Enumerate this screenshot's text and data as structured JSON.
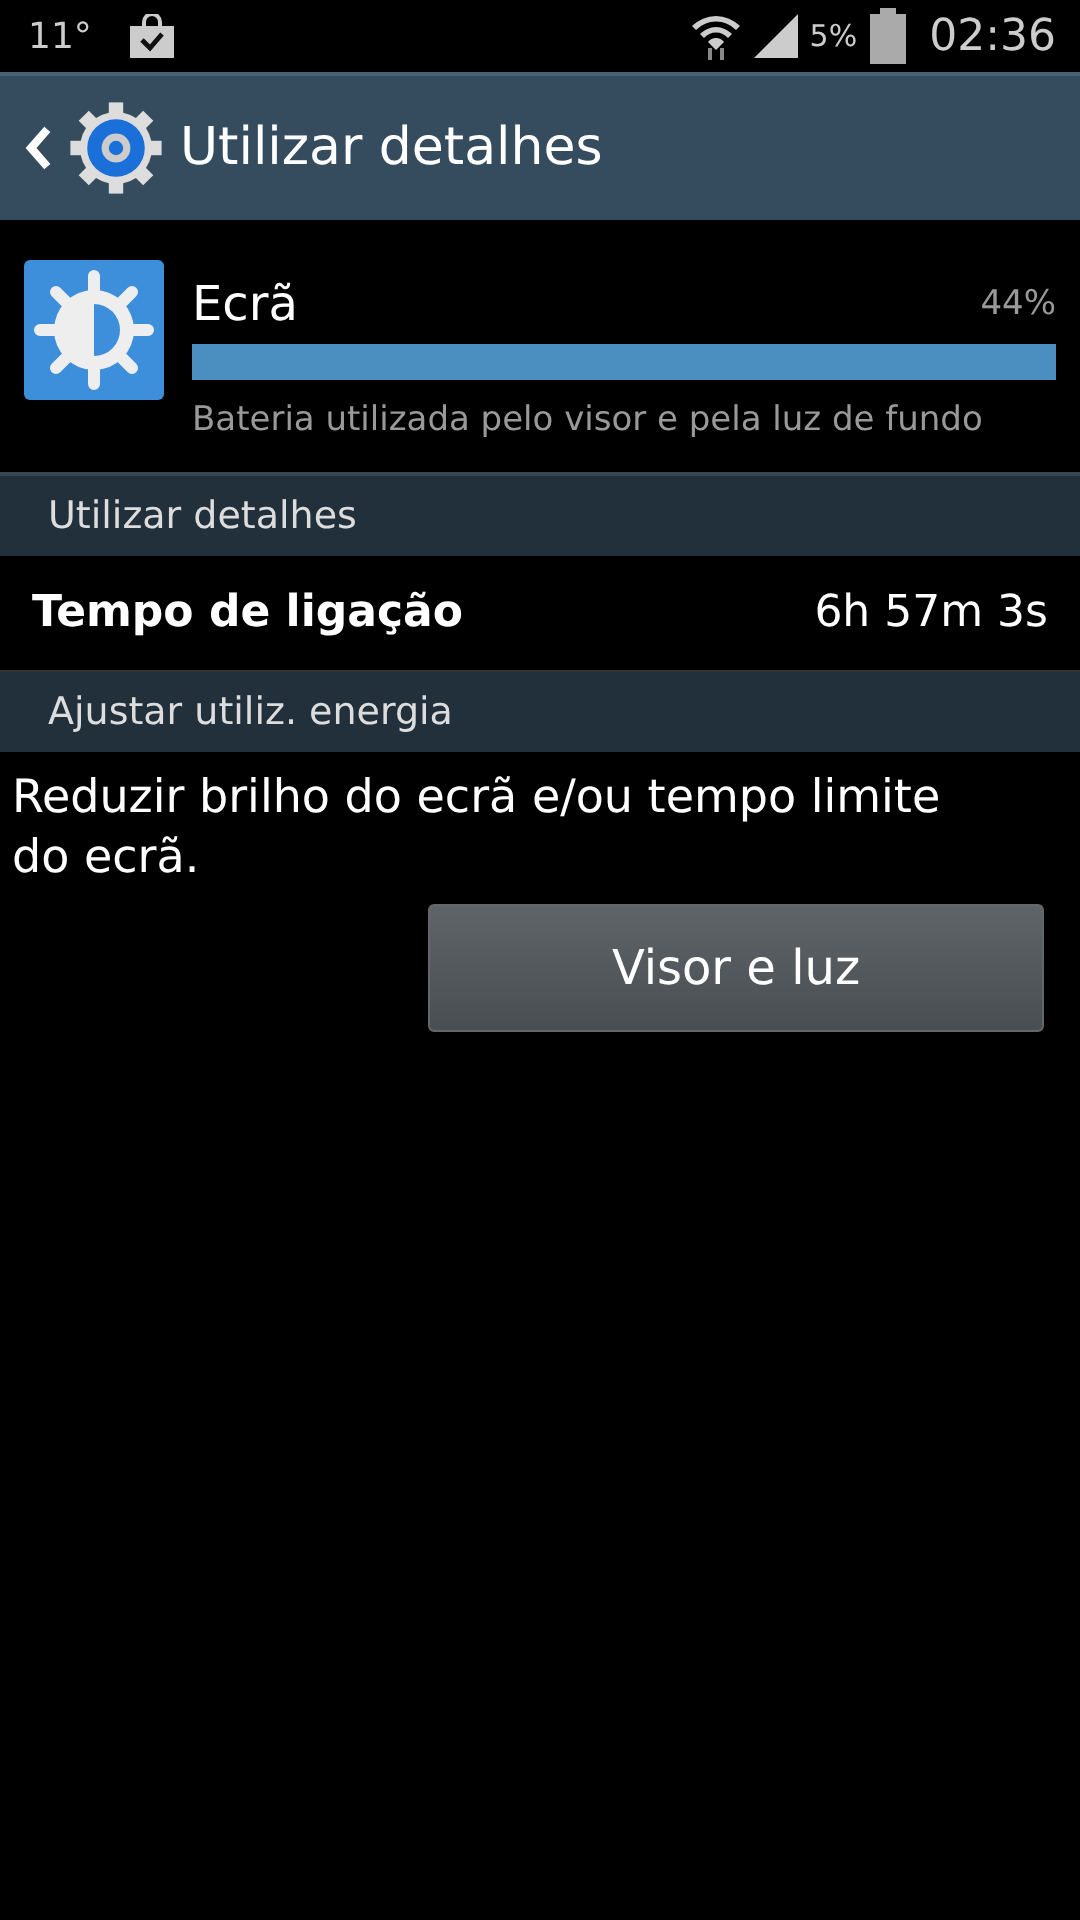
{
  "status_bar": {
    "temperature": "11°",
    "battery_percent": "5%",
    "time": "02:36"
  },
  "action_bar": {
    "title": "Utilizar detalhes"
  },
  "usage_item": {
    "name": "Ecrã",
    "percent": "44%",
    "level": 1.0,
    "description": "Bateria utilizada pelo visor e pela luz de fundo"
  },
  "sections": [
    {
      "header": "Utilizar detalhes",
      "rows": [
        {
          "label": "Tempo de ligação",
          "value": "6h 57m 3s"
        }
      ]
    },
    {
      "header": "Ajustar utiliz. energia",
      "text": "Reduzir brilho do ecrã e/ou tempo limite do ecrã.",
      "button": "Visor e luz"
    }
  ]
}
